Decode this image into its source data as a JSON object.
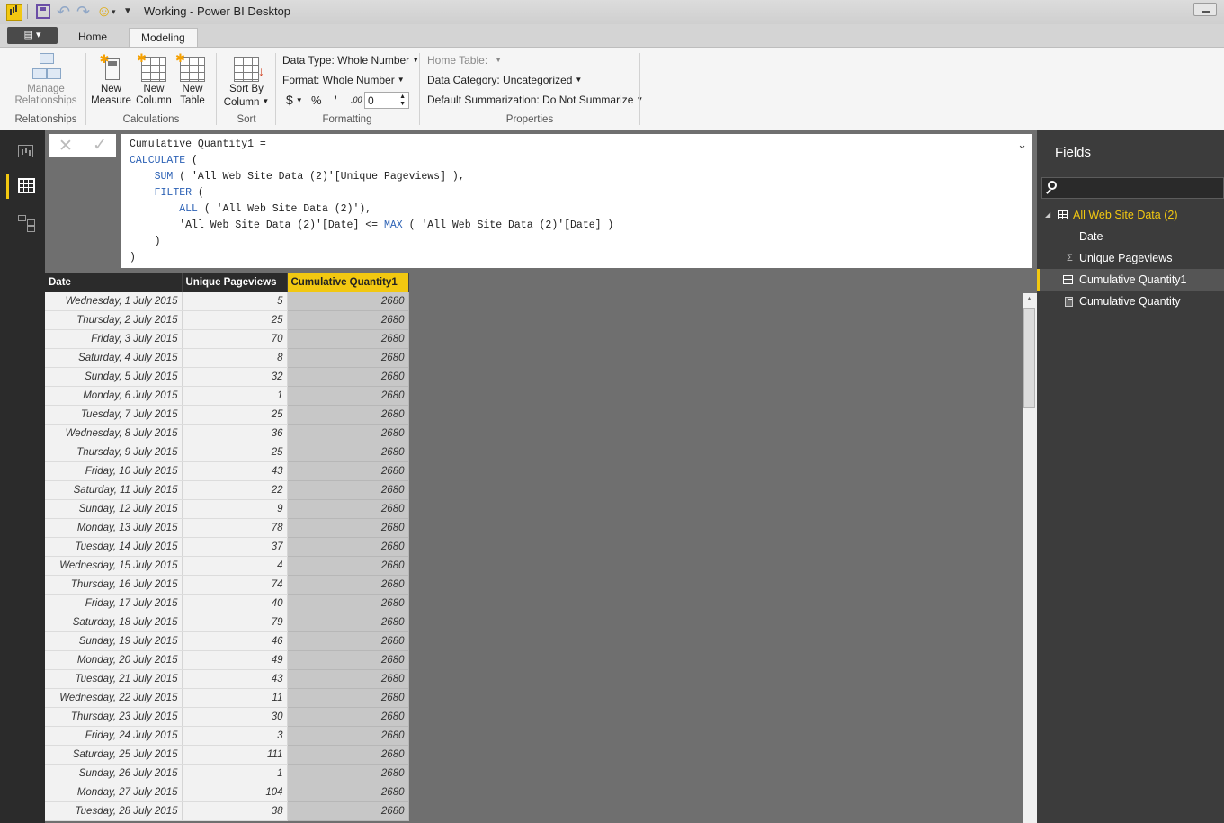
{
  "window": {
    "title": "Working - Power BI Desktop"
  },
  "ribbon": {
    "tabs": [
      "Home",
      "Modeling"
    ],
    "active_tab": "Modeling",
    "groups": {
      "relationships": {
        "label": "Relationships",
        "manage_line1": "Manage",
        "manage_line2": "Relationships"
      },
      "calculations": {
        "label": "Calculations",
        "new_measure_1": "New",
        "new_measure_2": "Measure",
        "new_column_1": "New",
        "new_column_2": "Column",
        "new_table_1": "New",
        "new_table_2": "Table"
      },
      "sort": {
        "label": "Sort",
        "sort_by_1": "Sort By",
        "sort_by_2": "Column"
      },
      "formatting": {
        "label": "Formatting",
        "data_type": "Data Type: Whole Number",
        "format": "Format: Whole Number",
        "currency": "$",
        "percent": "%",
        "comma": "’",
        "decimals_icon": ".00",
        "decimal_places": "0"
      },
      "properties": {
        "label": "Properties",
        "home_table": "Home Table:",
        "data_category": "Data Category: Uncategorized",
        "default_summarization": "Default Summarization: Do Not Summarize"
      }
    }
  },
  "formula": {
    "line1": "Cumulative Quantity1 =",
    "line2_kw": "CALCULATE",
    "line2_rest": " (",
    "line3_kw": "SUM",
    "line3_rest": " ( 'All Web Site Data (2)'[Unique Pageviews] ),",
    "line4_kw": "FILTER",
    "line4_rest": " (",
    "line5_kw": "ALL",
    "line5_rest": " ( 'All Web Site Data (2)'),",
    "line6_a": "'All Web Site Data (2)'[Date] <= ",
    "line6_kw": "MAX",
    "line6_b": " ( 'All Web Site Data (2)'[Date] )",
    "line7": ")",
    "line8": ")"
  },
  "table": {
    "columns": [
      "Date",
      "Unique Pageviews",
      "Cumulative Quantity1"
    ],
    "rows": [
      [
        "Wednesday, 1 July 2015",
        "5",
        "2680"
      ],
      [
        "Thursday, 2 July 2015",
        "25",
        "2680"
      ],
      [
        "Friday, 3 July 2015",
        "70",
        "2680"
      ],
      [
        "Saturday, 4 July 2015",
        "8",
        "2680"
      ],
      [
        "Sunday, 5 July 2015",
        "32",
        "2680"
      ],
      [
        "Monday, 6 July 2015",
        "1",
        "2680"
      ],
      [
        "Tuesday, 7 July 2015",
        "25",
        "2680"
      ],
      [
        "Wednesday, 8 July 2015",
        "36",
        "2680"
      ],
      [
        "Thursday, 9 July 2015",
        "25",
        "2680"
      ],
      [
        "Friday, 10 July 2015",
        "43",
        "2680"
      ],
      [
        "Saturday, 11 July 2015",
        "22",
        "2680"
      ],
      [
        "Sunday, 12 July 2015",
        "9",
        "2680"
      ],
      [
        "Monday, 13 July 2015",
        "78",
        "2680"
      ],
      [
        "Tuesday, 14 July 2015",
        "37",
        "2680"
      ],
      [
        "Wednesday, 15 July 2015",
        "4",
        "2680"
      ],
      [
        "Thursday, 16 July 2015",
        "74",
        "2680"
      ],
      [
        "Friday, 17 July 2015",
        "40",
        "2680"
      ],
      [
        "Saturday, 18 July 2015",
        "79",
        "2680"
      ],
      [
        "Sunday, 19 July 2015",
        "46",
        "2680"
      ],
      [
        "Monday, 20 July 2015",
        "49",
        "2680"
      ],
      [
        "Tuesday, 21 July 2015",
        "43",
        "2680"
      ],
      [
        "Wednesday, 22 July 2015",
        "11",
        "2680"
      ],
      [
        "Thursday, 23 July 2015",
        "30",
        "2680"
      ],
      [
        "Friday, 24 July 2015",
        "3",
        "2680"
      ],
      [
        "Saturday, 25 July 2015",
        "111",
        "2680"
      ],
      [
        "Sunday, 26 July 2015",
        "1",
        "2680"
      ],
      [
        "Monday, 27 July 2015",
        "104",
        "2680"
      ],
      [
        "Tuesday, 28 July 2015",
        "38",
        "2680"
      ]
    ]
  },
  "fields": {
    "title": "Fields",
    "table_name": "All Web Site Data (2)",
    "items": [
      {
        "label": "Date",
        "icon": "none"
      },
      {
        "label": "Unique Pageviews",
        "icon": "sigma-icon"
      },
      {
        "label": "Cumulative Quantity1",
        "icon": "calculated-column-icon"
      },
      {
        "label": "Cumulative Quantity",
        "icon": "measure-icon"
      }
    ]
  },
  "colors": {
    "accent": "#f2c811",
    "keyword": "#2d62b5"
  }
}
